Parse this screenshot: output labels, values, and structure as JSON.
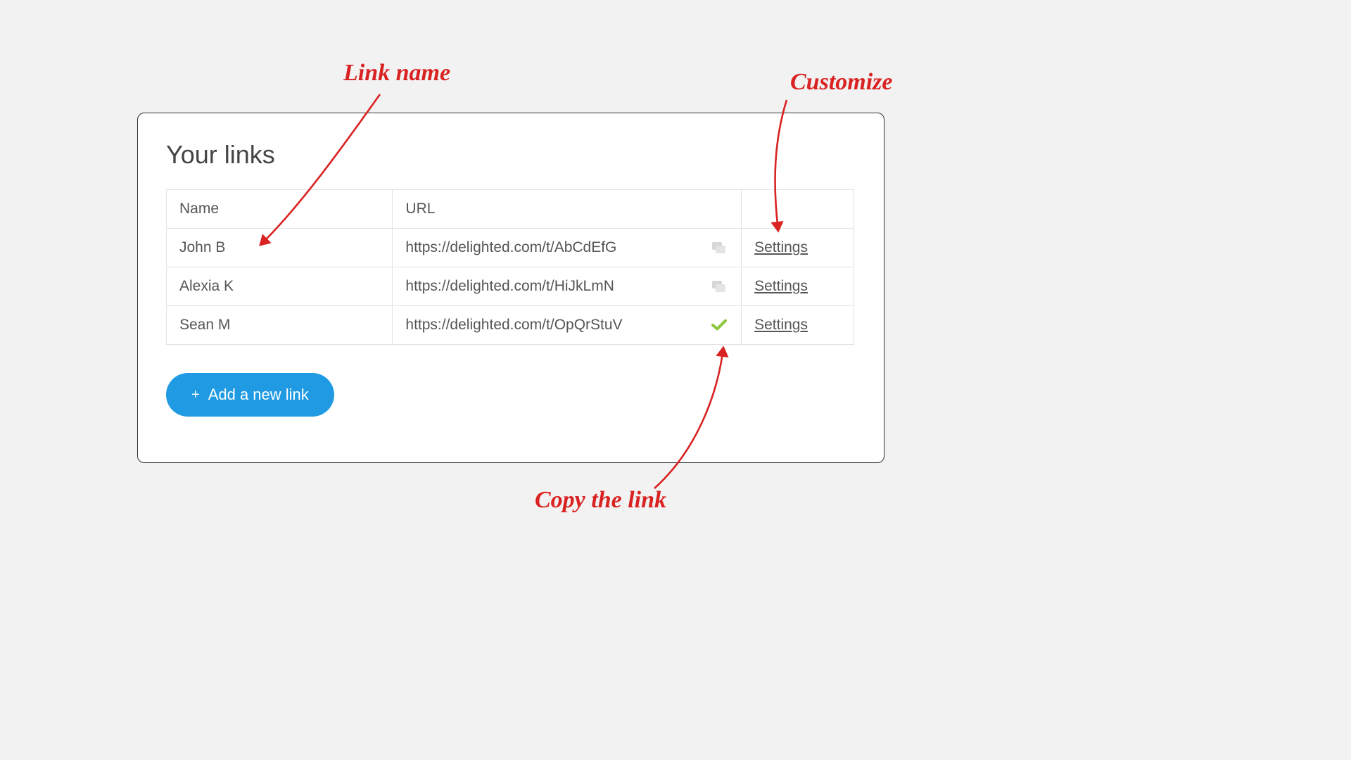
{
  "title": "Your links",
  "columns": {
    "name": "Name",
    "url": "URL"
  },
  "rows": [
    {
      "name": "John B",
      "url": "https://delighted.com/t/AbCdEfG",
      "copied": false,
      "settings": "Settings"
    },
    {
      "name": "Alexia K",
      "url": "https://delighted.com/t/HiJkLmN",
      "copied": false,
      "settings": "Settings"
    },
    {
      "name": "Sean M",
      "url": "https://delighted.com/t/OpQrStuV",
      "copied": true,
      "settings": "Settings"
    }
  ],
  "add_button": {
    "label": "Add a new link",
    "plus": "+"
  },
  "annotations": {
    "link_name": "Link name",
    "customize": "Customize",
    "copy_link": "Copy the link"
  },
  "colors": {
    "accent": "#1f9ae3",
    "annotation": "#d92222",
    "check": "#8fc63f"
  }
}
